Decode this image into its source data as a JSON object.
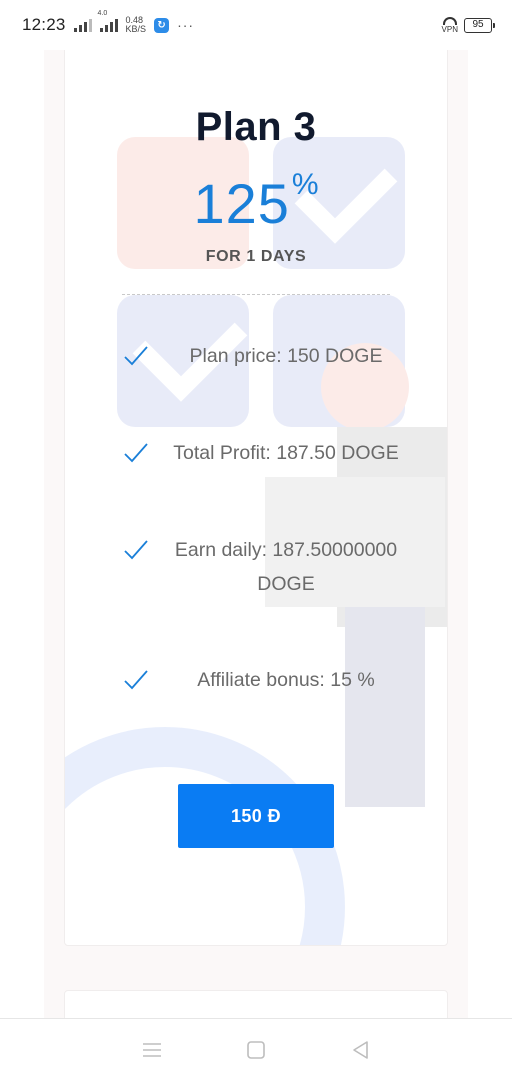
{
  "status_bar": {
    "time": "12:23",
    "net_speed_value": "0.48",
    "net_speed_unit": "KB/S",
    "signal_badge": "4.0",
    "more_indicator": "···",
    "vpn_label": "VPN",
    "battery": "95"
  },
  "plan": {
    "title": "Plan 3",
    "percent_value": "125",
    "percent_symbol": "%",
    "duration": "FOR 1 DAYS",
    "features": [
      {
        "icon": "check-icon",
        "text": "Plan price: 150 DOGE"
      },
      {
        "icon": "check-icon",
        "text": "Total Profit: 187.50 DOGE"
      },
      {
        "icon": "check-icon",
        "text": "Earn daily: 187.50000000 DOGE"
      },
      {
        "icon": "check-icon",
        "text": "Affiliate bonus: 15 %"
      }
    ],
    "button_label": "150 Đ"
  },
  "colors": {
    "accent": "#1a7fd8",
    "button": "#0a7cf3",
    "title": "#111a2e"
  },
  "nav_bar": {
    "icons": [
      "menu-icon",
      "home-square-icon",
      "back-triangle-icon"
    ]
  }
}
